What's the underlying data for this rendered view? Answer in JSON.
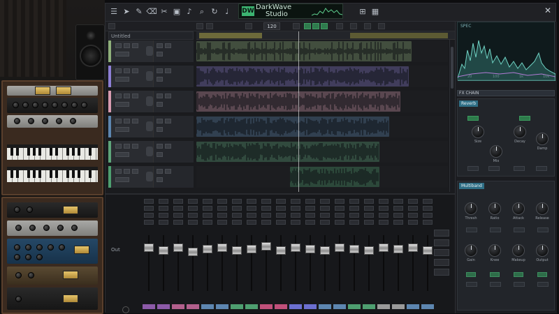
{
  "window": {
    "brand_line1": "DarkWave",
    "brand_line2": "Studio",
    "brand_mark": "DW"
  },
  "icons": {
    "toolbar": [
      "menu-icon",
      "arrow-icon",
      "pencil-icon",
      "eraser-icon",
      "scissors-icon",
      "glue-icon",
      "mute-tool-icon",
      "zoom-icon",
      "loop-icon",
      "metronome-icon",
      "snap-icon",
      "grid-icon"
    ],
    "close": "close-icon"
  },
  "arrange": {
    "track_header_label": "Untitled",
    "tempo_display": "120"
  },
  "colors": {
    "track1": "#8fb07a",
    "track2": "#8d7fd6",
    "track3": "#d89bb0",
    "track4": "#5d86b0",
    "track5": "#5ea57a",
    "track6": "#4e9f70",
    "accent_green": "#3cb371",
    "accent_teal": "#2f6f86"
  },
  "mixer": {
    "side_label": "Out",
    "strip_count": 20
  },
  "rpanel": {
    "spectrum_title": "SPEC",
    "spectrum_axis": [
      "20",
      "100",
      "1k",
      "10k"
    ],
    "fx1_header": "FX CHAIN",
    "fx1_title": "Reverb",
    "fx1_knobs": [
      "Size",
      "Decay",
      "Damp",
      "Mix",
      "Width"
    ],
    "fx2_title": "Multiband",
    "fx2_knobs": [
      "Thresh",
      "Ratio",
      "Attack",
      "Release",
      "Gain",
      "Knee",
      "Makeup",
      "Output"
    ]
  }
}
